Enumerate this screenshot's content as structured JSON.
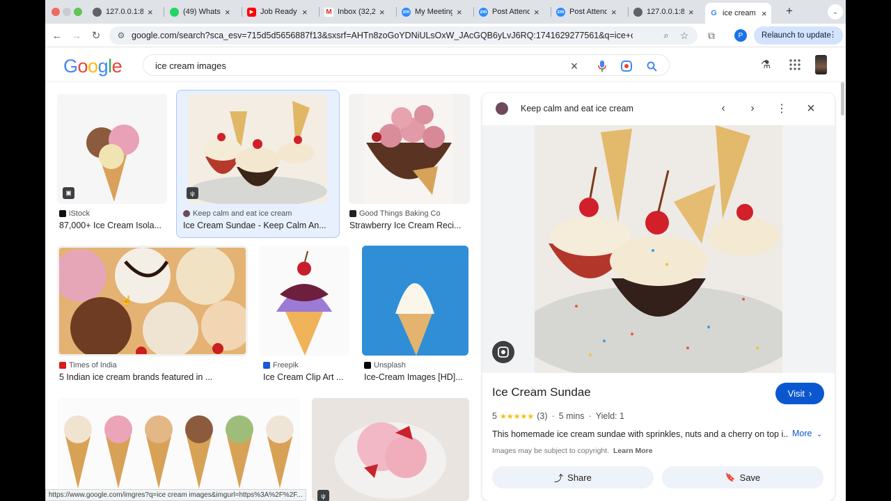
{
  "browser": {
    "tabs": [
      {
        "title": "127.0.0.1:8",
        "icon": "globe-icon"
      },
      {
        "title": "(49) Whats",
        "icon": "whatsapp-icon"
      },
      {
        "title": "Job Ready",
        "icon": "youtube-icon"
      },
      {
        "title": "Inbox (32,2",
        "icon": "gmail-icon"
      },
      {
        "title": "My Meeting",
        "icon": "zoom-icon"
      },
      {
        "title": "Post Attend",
        "icon": "zoom-icon"
      },
      {
        "title": "Post Attend",
        "icon": "zoom-icon"
      },
      {
        "title": "127.0.0.1:8",
        "icon": "globe-icon"
      },
      {
        "title": "ice cream in",
        "icon": "google-icon"
      }
    ],
    "url": "google.com/search?sca_esv=715d5d5656887f13&sxsrf=AHTn8zoGoYDNiULsOxW_JAcGQB6yLvJ6RQ:1741629277561&q=ice+cream+imag...",
    "relaunch_label": "Relaunch to update",
    "profile_initial": "P",
    "status_url": "https://www.google.com/imgres?q=ice cream images&imgurl=https%3A%2F%2F..."
  },
  "search": {
    "logo": "Google",
    "query": "ice cream images"
  },
  "results": [
    {
      "source": "iStock",
      "caption": "87,000+ Ice Cream Isola..."
    },
    {
      "source": "Keep calm and eat ice cream",
      "caption": "Ice Cream Sundae - Keep Calm An..."
    },
    {
      "source": "Good Things Baking Co",
      "caption": "Strawberry Ice Cream Reci..."
    },
    {
      "source": "Times of India",
      "caption": "5 Indian ice cream brands featured in ..."
    },
    {
      "source": "Freepik",
      "caption": "Ice Cream Clip Art ..."
    },
    {
      "source": "Unsplash",
      "caption": "Ice-Cream Images [HD]..."
    }
  ],
  "panel": {
    "site_name": "Keep calm and eat ice cream",
    "title": "Ice Cream Sundae",
    "visit_label": "Visit",
    "rating": "5",
    "stars": "★★★★★",
    "rating_count": "(3)",
    "time": "5 mins",
    "yield": "Yield: 1",
    "description": "This homemade ice cream sundae with sprinkles, nuts and a cherry on top i...",
    "more_label": "More",
    "copyright_note": "Images may be subject to copyright.",
    "learn_more": "Learn More",
    "share_label": "Share",
    "save_label": "Save"
  },
  "colors": {
    "accent": "#0b57d0",
    "selected_border": "#a8c7fa"
  }
}
